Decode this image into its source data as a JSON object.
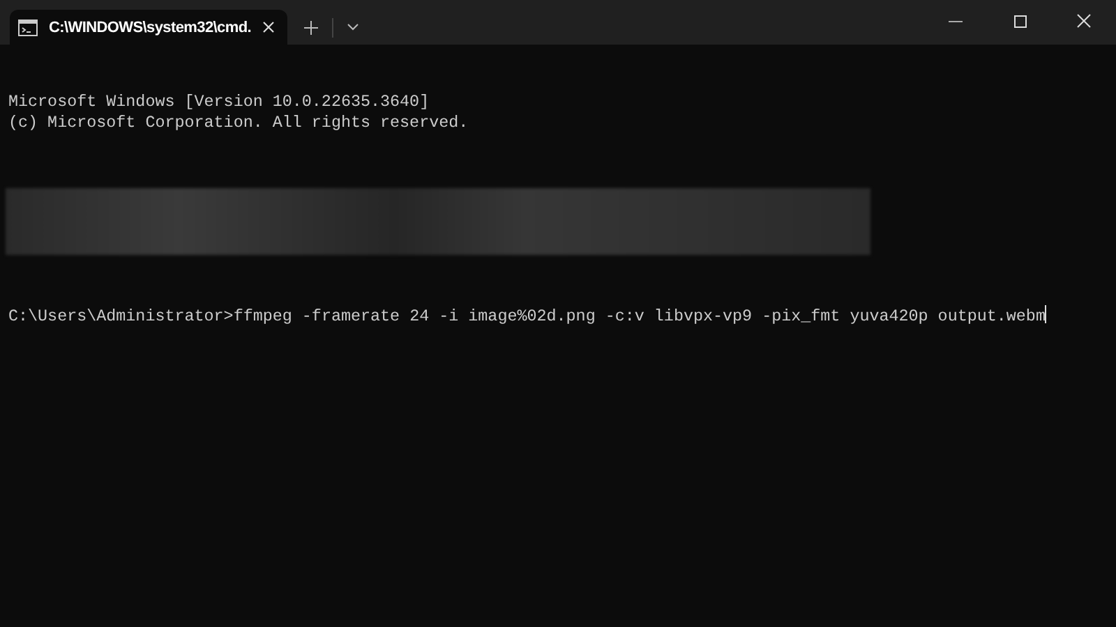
{
  "window": {
    "tab": {
      "title": "C:\\WINDOWS\\system32\\cmd.",
      "selected": true
    }
  },
  "console": {
    "lines": [
      "Microsoft Windows [Version 10.0.22635.3640]",
      "(c) Microsoft Corporation. All rights reserved."
    ],
    "prompt": "C:\\Users\\Administrator>",
    "command": "ffmpeg -framerate 24 -i image%02d.png -c:v libvpx-vp9 -pix_fmt yuva420p output.webm"
  }
}
